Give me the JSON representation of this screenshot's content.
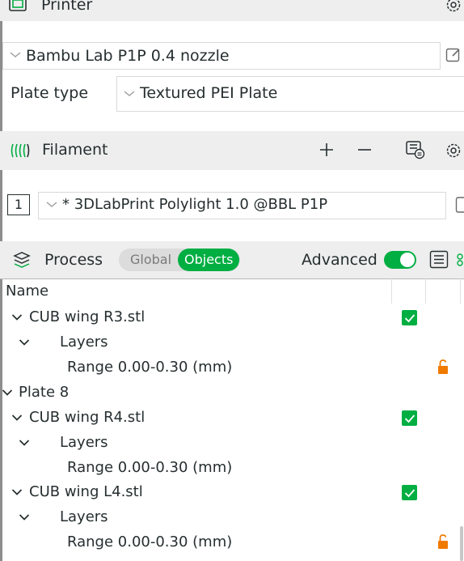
{
  "printer": {
    "title": "Printer",
    "model": "Bambu Lab P1P 0.4 nozzle",
    "plate_type_label": "Plate type",
    "plate_type_value": "Textured PEI Plate"
  },
  "filament": {
    "title": "Filament",
    "slot_number": "1",
    "item": "* 3DLabPrint Polylight 1.0 @BBL P1P"
  },
  "process": {
    "title": "Process",
    "tabs": [
      "Global",
      "Objects"
    ],
    "active_tab": "Objects",
    "advanced_label": "Advanced",
    "advanced_on": true
  },
  "tree": {
    "header_name": "Name",
    "rows": [
      {
        "label": "CUB wing R3.stl"
      },
      {
        "label": "Layers"
      },
      {
        "label": "Range 0.00-0.30 (mm)"
      },
      {
        "label": "Plate 8"
      },
      {
        "label": "CUB wing R4.stl"
      },
      {
        "label": "Layers"
      },
      {
        "label": "Range 0.00-0.30 (mm)"
      },
      {
        "label": "CUB wing L4.stl"
      },
      {
        "label": "Layers"
      },
      {
        "label": "Range 0.00-0.30 (mm)"
      }
    ]
  },
  "colors": {
    "accent": "#00ae42",
    "lock": "#f07a00",
    "band": "#eeeeee"
  },
  "icons": [
    "printer-icon",
    "settings-icon",
    "edit-icon",
    "filament-icon",
    "add-icon",
    "remove-icon",
    "filament-sync-icon",
    "process-icon",
    "list-icon",
    "chevron-down-icon",
    "checkbox-checked-icon",
    "lock-icon"
  ]
}
